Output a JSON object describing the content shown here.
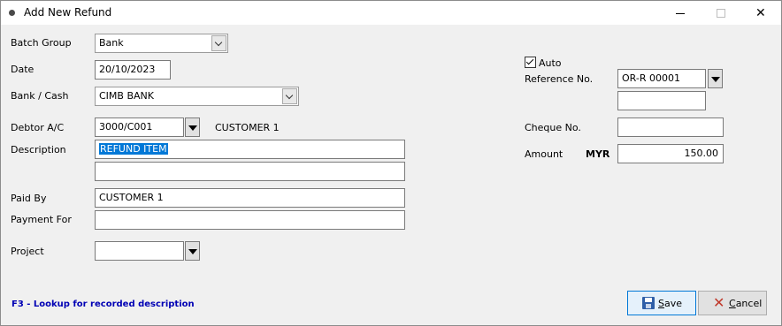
{
  "window": {
    "title": "Add New Refund"
  },
  "form": {
    "batch_group": {
      "label": "Batch Group",
      "value": "Bank"
    },
    "date": {
      "label": "Date",
      "value": "20/10/2023"
    },
    "bank_cash": {
      "label": "Bank / Cash",
      "value": "CIMB BANK"
    },
    "debtor": {
      "label": "Debtor A/C",
      "value": "3000/C001",
      "name": "CUSTOMER 1"
    },
    "description": {
      "label": "Description",
      "value": "REFUND ITEM",
      "value2": ""
    },
    "paid_by": {
      "label": "Paid By",
      "value": "CUSTOMER 1"
    },
    "payment_for": {
      "label": "Payment For",
      "value": ""
    },
    "project": {
      "label": "Project",
      "value": ""
    },
    "auto": {
      "label": "Auto",
      "checked": true
    },
    "reference": {
      "label": "Reference No.",
      "value": "OR-R 00001",
      "value2": ""
    },
    "cheque": {
      "label": "Cheque No.",
      "value": ""
    },
    "amount": {
      "label": "Amount",
      "currency": "MYR",
      "value": "150.00"
    }
  },
  "hint": "F3 - Lookup for recorded description",
  "buttons": {
    "save": "Save",
    "cancel": "Cancel"
  }
}
